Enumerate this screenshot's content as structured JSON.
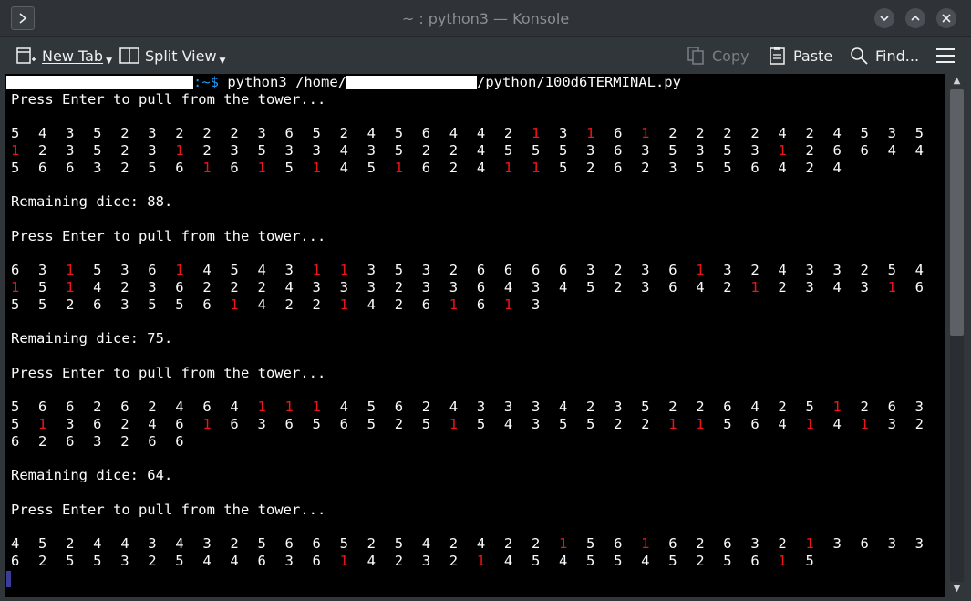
{
  "window": {
    "title": "~ : python3 — Konsole"
  },
  "toolbar": {
    "new_tab": "New Tab",
    "split_view": "Split View",
    "copy": "Copy",
    "paste": "Paste",
    "find": "Find..."
  },
  "terminal": {
    "command": {
      "prompt_suffix": ":~$",
      "cmd_pre": "python3 /home/",
      "cmd_post": "/python/100d6TERMINAL.py"
    },
    "press_prompt": "Press Enter to pull from the tower...",
    "blocks": [
      {
        "rows": [
          [
            5,
            4,
            3,
            5,
            2,
            3,
            2,
            2,
            2,
            3,
            6,
            5,
            2,
            4,
            5,
            6,
            4,
            4,
            2,
            1,
            3,
            1,
            6,
            1,
            2,
            2,
            2,
            2,
            4,
            2,
            4,
            5,
            3,
            5
          ],
          [
            1,
            2,
            3,
            5,
            2,
            3,
            1,
            2,
            3,
            5,
            3,
            3,
            4,
            3,
            5,
            2,
            2,
            4,
            5,
            5,
            5,
            3,
            6,
            3,
            5,
            3,
            5,
            3,
            1,
            2,
            6,
            6,
            4,
            4
          ],
          [
            5,
            6,
            6,
            3,
            2,
            5,
            6,
            1,
            6,
            1,
            5,
            1,
            4,
            5,
            1,
            6,
            2,
            4,
            1,
            1,
            5,
            2,
            6,
            2,
            3,
            5,
            5,
            6,
            4,
            2,
            4
          ]
        ],
        "remaining": "Remaining dice: 88."
      },
      {
        "rows": [
          [
            6,
            3,
            1,
            5,
            3,
            6,
            1,
            4,
            5,
            4,
            3,
            1,
            1,
            3,
            5,
            3,
            2,
            6,
            6,
            6,
            6,
            3,
            2,
            3,
            6,
            1,
            3,
            2,
            4,
            3,
            3,
            2,
            5,
            4
          ],
          [
            1,
            5,
            1,
            4,
            2,
            3,
            6,
            2,
            2,
            2,
            4,
            3,
            3,
            3,
            2,
            3,
            3,
            6,
            4,
            3,
            4,
            5,
            2,
            3,
            6,
            4,
            2,
            1,
            2,
            3,
            4,
            3,
            1,
            6
          ],
          [
            5,
            5,
            2,
            6,
            3,
            5,
            5,
            6,
            1,
            4,
            2,
            2,
            1,
            4,
            2,
            6,
            1,
            6,
            1,
            3
          ]
        ],
        "remaining": "Remaining dice: 75."
      },
      {
        "rows": [
          [
            5,
            6,
            6,
            2,
            6,
            2,
            4,
            6,
            4,
            1,
            1,
            1,
            4,
            5,
            6,
            2,
            4,
            3,
            3,
            3,
            4,
            2,
            3,
            5,
            2,
            2,
            6,
            4,
            2,
            5,
            1,
            2,
            6,
            3
          ],
          [
            5,
            1,
            3,
            6,
            2,
            4,
            6,
            1,
            6,
            3,
            6,
            5,
            6,
            5,
            2,
            5,
            1,
            5,
            4,
            3,
            5,
            5,
            2,
            2,
            1,
            1,
            5,
            6,
            4,
            1,
            4,
            1,
            3,
            2
          ],
          [
            6,
            2,
            6,
            3,
            2,
            6,
            6
          ]
        ],
        "remaining": "Remaining dice: 64."
      },
      {
        "rows": [
          [
            4,
            5,
            2,
            4,
            4,
            3,
            4,
            3,
            2,
            5,
            6,
            6,
            5,
            2,
            5,
            4,
            2,
            4,
            2,
            2,
            1,
            5,
            6,
            1,
            6,
            2,
            6,
            3,
            2,
            1,
            3,
            6,
            3,
            3
          ],
          [
            6,
            2,
            5,
            5,
            3,
            2,
            5,
            4,
            4,
            6,
            3,
            6,
            1,
            4,
            2,
            3,
            2,
            1,
            4,
            5,
            4,
            5,
            5,
            4,
            5,
            2,
            5,
            6,
            1,
            5
          ]
        ]
      }
    ]
  },
  "colors": {
    "terminal_bg": "#000000",
    "terminal_fg": "#fcfcfc",
    "one_die": "#ed1515",
    "prompt_path": "#1d99f3"
  }
}
